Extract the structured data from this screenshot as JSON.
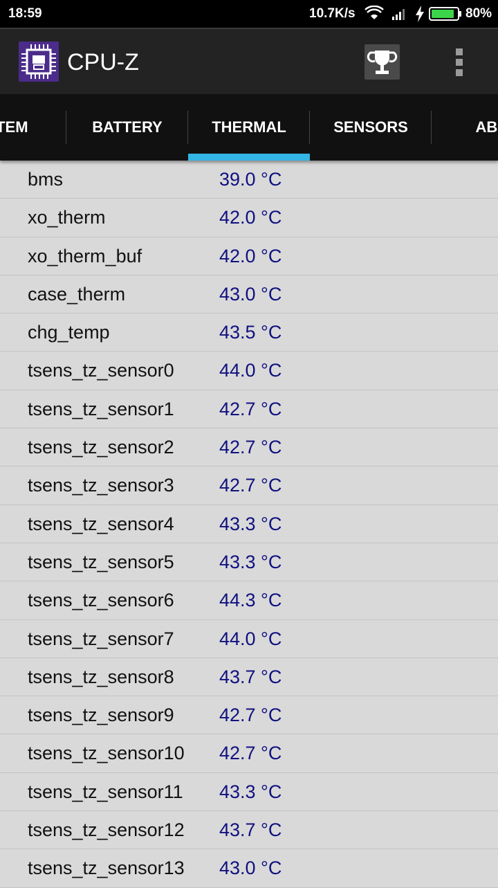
{
  "status_bar": {
    "time": "18:59",
    "net_speed": "10.7K/s",
    "battery_pct": "80%",
    "icons": [
      "wifi-icon",
      "signal-icon",
      "charging-bolt-icon",
      "battery-icon"
    ],
    "battery_color": "#3cd44a"
  },
  "app": {
    "title": "CPU-Z",
    "logo_color": "#4b2c8a"
  },
  "tabs": [
    {
      "label": "STEM",
      "active": false
    },
    {
      "label": "BATTERY",
      "active": false
    },
    {
      "label": "THERMAL",
      "active": true
    },
    {
      "label": "SENSORS",
      "active": false
    },
    {
      "label": "ABO",
      "active": false
    }
  ],
  "accent_color": "#33b5e5",
  "value_color": "#101080",
  "thermal": [
    {
      "name": "bms",
      "value": "39.0 °C"
    },
    {
      "name": "xo_therm",
      "value": "42.0 °C"
    },
    {
      "name": "xo_therm_buf",
      "value": "42.0 °C"
    },
    {
      "name": "case_therm",
      "value": "43.0 °C"
    },
    {
      "name": "chg_temp",
      "value": "43.5 °C"
    },
    {
      "name": "tsens_tz_sensor0",
      "value": "44.0 °C"
    },
    {
      "name": "tsens_tz_sensor1",
      "value": "42.7 °C"
    },
    {
      "name": "tsens_tz_sensor2",
      "value": "42.7 °C"
    },
    {
      "name": "tsens_tz_sensor3",
      "value": "42.7 °C"
    },
    {
      "name": "tsens_tz_sensor4",
      "value": "43.3 °C"
    },
    {
      "name": "tsens_tz_sensor5",
      "value": "43.3 °C"
    },
    {
      "name": "tsens_tz_sensor6",
      "value": "44.3 °C"
    },
    {
      "name": "tsens_tz_sensor7",
      "value": "44.0 °C"
    },
    {
      "name": "tsens_tz_sensor8",
      "value": "43.7 °C"
    },
    {
      "name": "tsens_tz_sensor9",
      "value": "42.7 °C"
    },
    {
      "name": "tsens_tz_sensor10",
      "value": "42.7 °C"
    },
    {
      "name": "tsens_tz_sensor11",
      "value": "43.3 °C"
    },
    {
      "name": "tsens_tz_sensor12",
      "value": "43.7 °C"
    },
    {
      "name": "tsens_tz_sensor13",
      "value": "43.0 °C"
    }
  ]
}
